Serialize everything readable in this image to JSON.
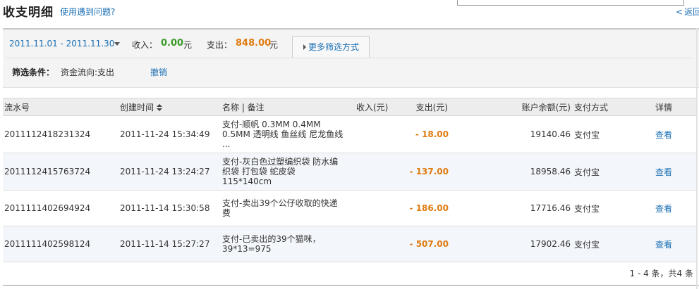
{
  "header": {
    "title": "收支明细",
    "help_link": "使用遇到问题?",
    "back_chevron": "<",
    "back_link": "返回"
  },
  "filter": {
    "date_range": "2011.11.01 - 2011.11.30",
    "income_label": "收入：",
    "income_value": "0.00",
    "income_unit": "元",
    "expense_label": "支出：",
    "expense_value": "848.00",
    "expense_unit": "元",
    "more_filter": "更多筛选方式",
    "condition_label": "筛选条件：",
    "condition_value": "资金流向:支出",
    "revoke": "撤销"
  },
  "table": {
    "columns": {
      "serial": "流水号",
      "time": "创建时间",
      "name": "名称 | 备注",
      "income": "收入(元)",
      "expense": "支出(元)",
      "balance": "账户余额(元)",
      "method": "支付方式",
      "detail": "详情"
    },
    "rows": [
      {
        "serial": "2011112418231324",
        "time": "2011-11-24 15:34:49",
        "name_lines": [
          "支付-顺帆 0.3MM 0.4MM",
          "0.5MM 透明线 鱼丝线 尼龙鱼线",
          "..."
        ],
        "income": "",
        "expense": "- 18.00",
        "balance": "19140.46",
        "method": "支付宝",
        "detail": "查看"
      },
      {
        "serial": "2011112415763724",
        "time": "2011-11-24 13:24:27",
        "name_lines": [
          "支付-灰白色过塑编织袋 防水编",
          "织袋 打包袋 蛇皮袋",
          "115*140cm"
        ],
        "income": "",
        "expense": "- 137.00",
        "balance": "18958.46",
        "method": "支付宝",
        "detail": "查看"
      },
      {
        "serial": "2011111402694924",
        "time": "2011-11-14 15:30:58",
        "name_lines": [
          "支付-卖出39个公仔收取的快递",
          "费"
        ],
        "income": "",
        "expense": "- 186.00",
        "balance": "17716.46",
        "method": "支付宝",
        "detail": "查看"
      },
      {
        "serial": "2011111402598124",
        "time": "2011-11-14 15:27:27",
        "name_lines": [
          "支付-已卖出的39个猫咪，",
          "39*13=975"
        ],
        "income": "",
        "expense": "- 507.00",
        "balance": "17902.46",
        "method": "支付宝",
        "detail": "查看"
      }
    ]
  },
  "pager": {
    "summary": "1 - 4 条，共4 条"
  },
  "colors": {
    "link": "#1a6fb3",
    "income_green": "#3a9a2a",
    "expense_orange": "#e07b10"
  }
}
